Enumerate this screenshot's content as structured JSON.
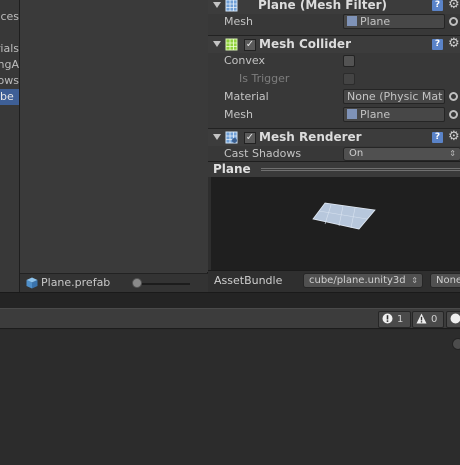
{
  "hierarchy": {
    "items": [
      {
        "label": "ces",
        "selected": false
      },
      {
        "label": "rials",
        "selected": false
      },
      {
        "label": "ngA",
        "selected": false
      },
      {
        "label": "ows",
        "selected": false
      },
      {
        "label": "be",
        "selected": true
      }
    ]
  },
  "project": {
    "selected_asset": "Plane.prefab",
    "asset_icon": "prefab-cube-icon"
  },
  "inspector": {
    "mesh_filter": {
      "title": "Plane (Mesh Filter)",
      "mesh_label": "Mesh",
      "mesh_value": "Plane"
    },
    "mesh_collider": {
      "title": "Mesh Collider",
      "enabled": true,
      "convex_label": "Convex",
      "is_trigger_label": "Is Trigger",
      "material_label": "Material",
      "material_value": "None (Physic Mat",
      "mesh_label": "Mesh",
      "mesh_value": "Plane"
    },
    "mesh_renderer": {
      "title": "Mesh Renderer",
      "enabled": true,
      "cast_shadows_label": "Cast Shadows",
      "cast_shadows_value": "On"
    }
  },
  "preview": {
    "title": "Plane",
    "assetbundle_label": "AssetBundle",
    "assetbundle_value": "cube/plane.unity3d",
    "variant_value": "None"
  },
  "console": {
    "error_count": "1",
    "warning_count": "0"
  },
  "colors": {
    "selection": "#3e5f96",
    "help_icon": "#5a83c8"
  }
}
